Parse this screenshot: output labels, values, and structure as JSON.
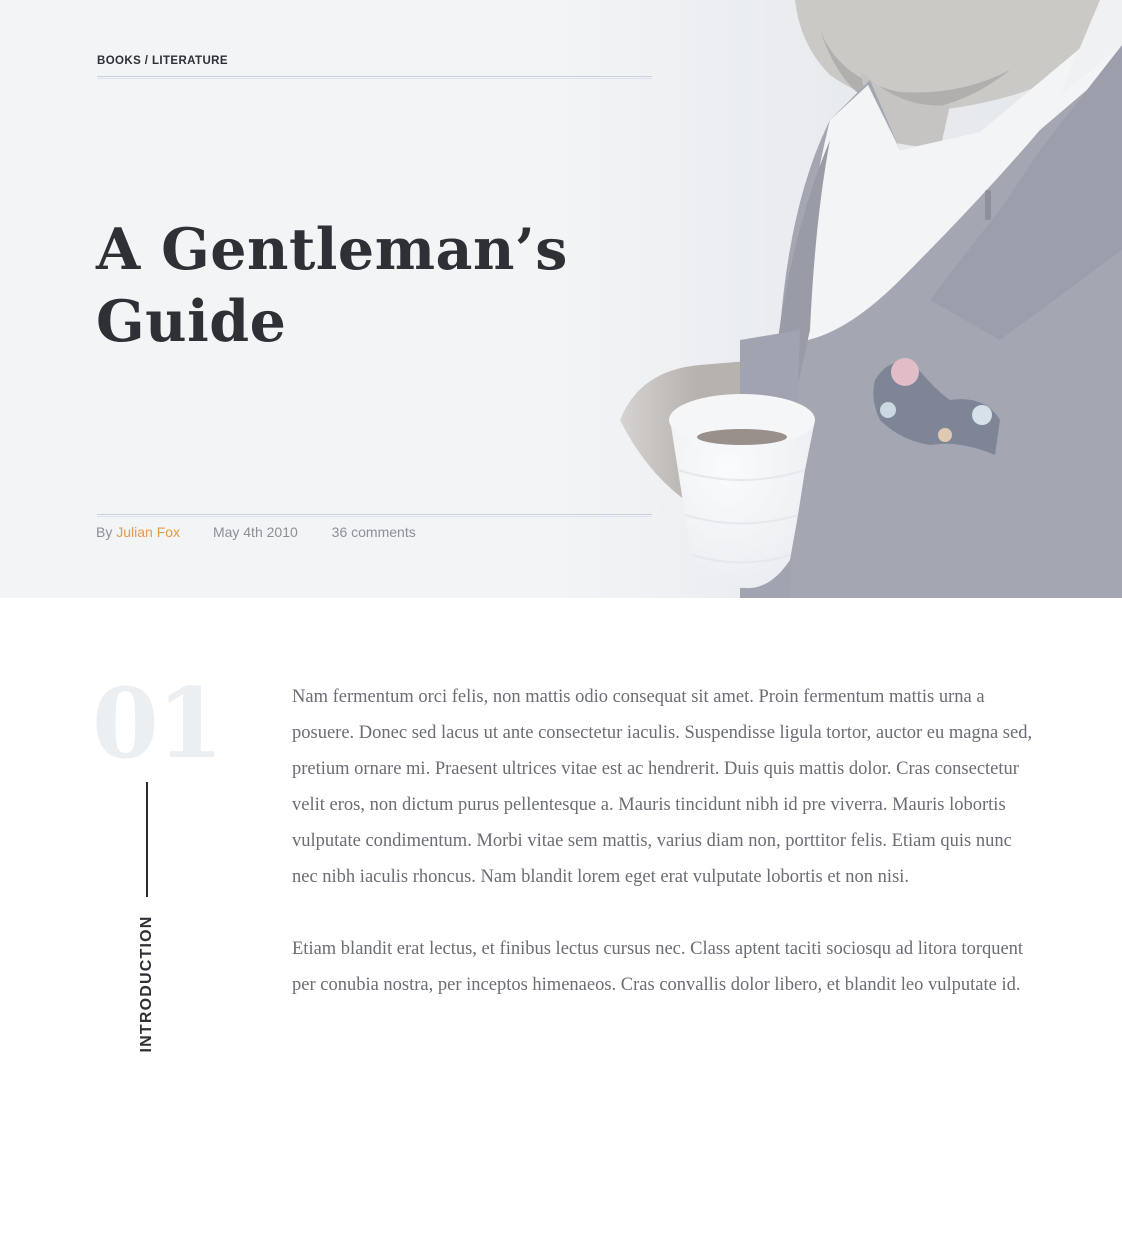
{
  "hero": {
    "breadcrumb": "BOOKS / LITERATURE",
    "title_line_1": "A Gentleman’s",
    "title_line_2": "Guide",
    "meta": {
      "by": "By",
      "author": "Julian Fox",
      "date": "May 4th 2010",
      "comments": "36 comments"
    }
  },
  "section": {
    "number": "01",
    "label": "INTRODUCTION"
  },
  "article": {
    "paragraphs": [
      "Nam fermentum orci felis, non mattis odio consequat sit amet. Proin fermentum mattis urna a posuere. Donec sed lacus ut ante consectetur iaculis. Suspendisse ligula tortor, auctor eu magna sed, pretium ornare mi. Praesent ultrices vitae est ac hendrerit. Duis quis mattis dolor. Cras consectetur velit eros, non dictum purus pellentesque a. Mauris tincidunt nibh id pre viverra. Mauris lobortis vulputate condimentum. Morbi vitae sem mattis, varius diam non, porttitor felis. Etiam quis nunc nec nibh iaculis rhoncus. Nam blandit lorem eget erat vulputate lobortis et non nisi.",
      "Etiam blandit erat lectus, et finibus lectus cursus nec. Class aptent taciti sociosqu ad litora torquent per conubia nostra, per inceptos himenaeos. Cras convallis dolor libero, et blandit leo vulputate id."
    ]
  },
  "colors": {
    "author_accent": "#e49a4a",
    "heading": "#2e3036",
    "body_text": "#6a6d74",
    "meta_text": "#8b8f98",
    "section_number": "#eceff2"
  },
  "icons": {
    "hero_photo": "man-in-suit-holding-coffee-cup"
  }
}
